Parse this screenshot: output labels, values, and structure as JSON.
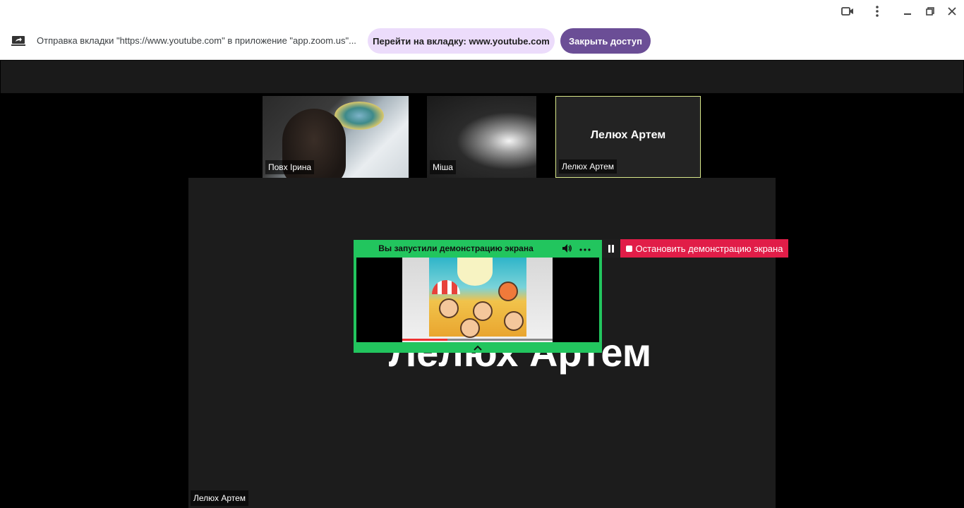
{
  "banner": {
    "share_text": "Отправка вкладки \"https://www.youtube.com\" в приложение \"app.zoom.us\"...",
    "goto_label": "Перейти на вкладку: www.youtube.com",
    "stop_access_label": "Закрыть доступ"
  },
  "window_controls": [
    "camera-icon",
    "more-vert-icon",
    "minimize-icon",
    "restore-icon",
    "close-icon"
  ],
  "participants": [
    {
      "name": "Повх Ірина",
      "video": true
    },
    {
      "name": "Міша",
      "video": true
    },
    {
      "name": "Лелюх Артем",
      "video": false,
      "display_name": "Лелюх Артем",
      "active": true
    }
  ],
  "main_view": {
    "big_name": "Лелюх Артем",
    "label": "Лелюх Артем"
  },
  "share_panel": {
    "title": "Вы запустили демонстрацию экрана",
    "stop_label": "Остановить демонстрацию экрана"
  },
  "colors": {
    "share_green": "#22c55e",
    "stop_red": "#e11d48",
    "accent_purple": "#6b4e96",
    "goto_bg": "#ecdcfb",
    "active_border": "#d9e88a"
  }
}
